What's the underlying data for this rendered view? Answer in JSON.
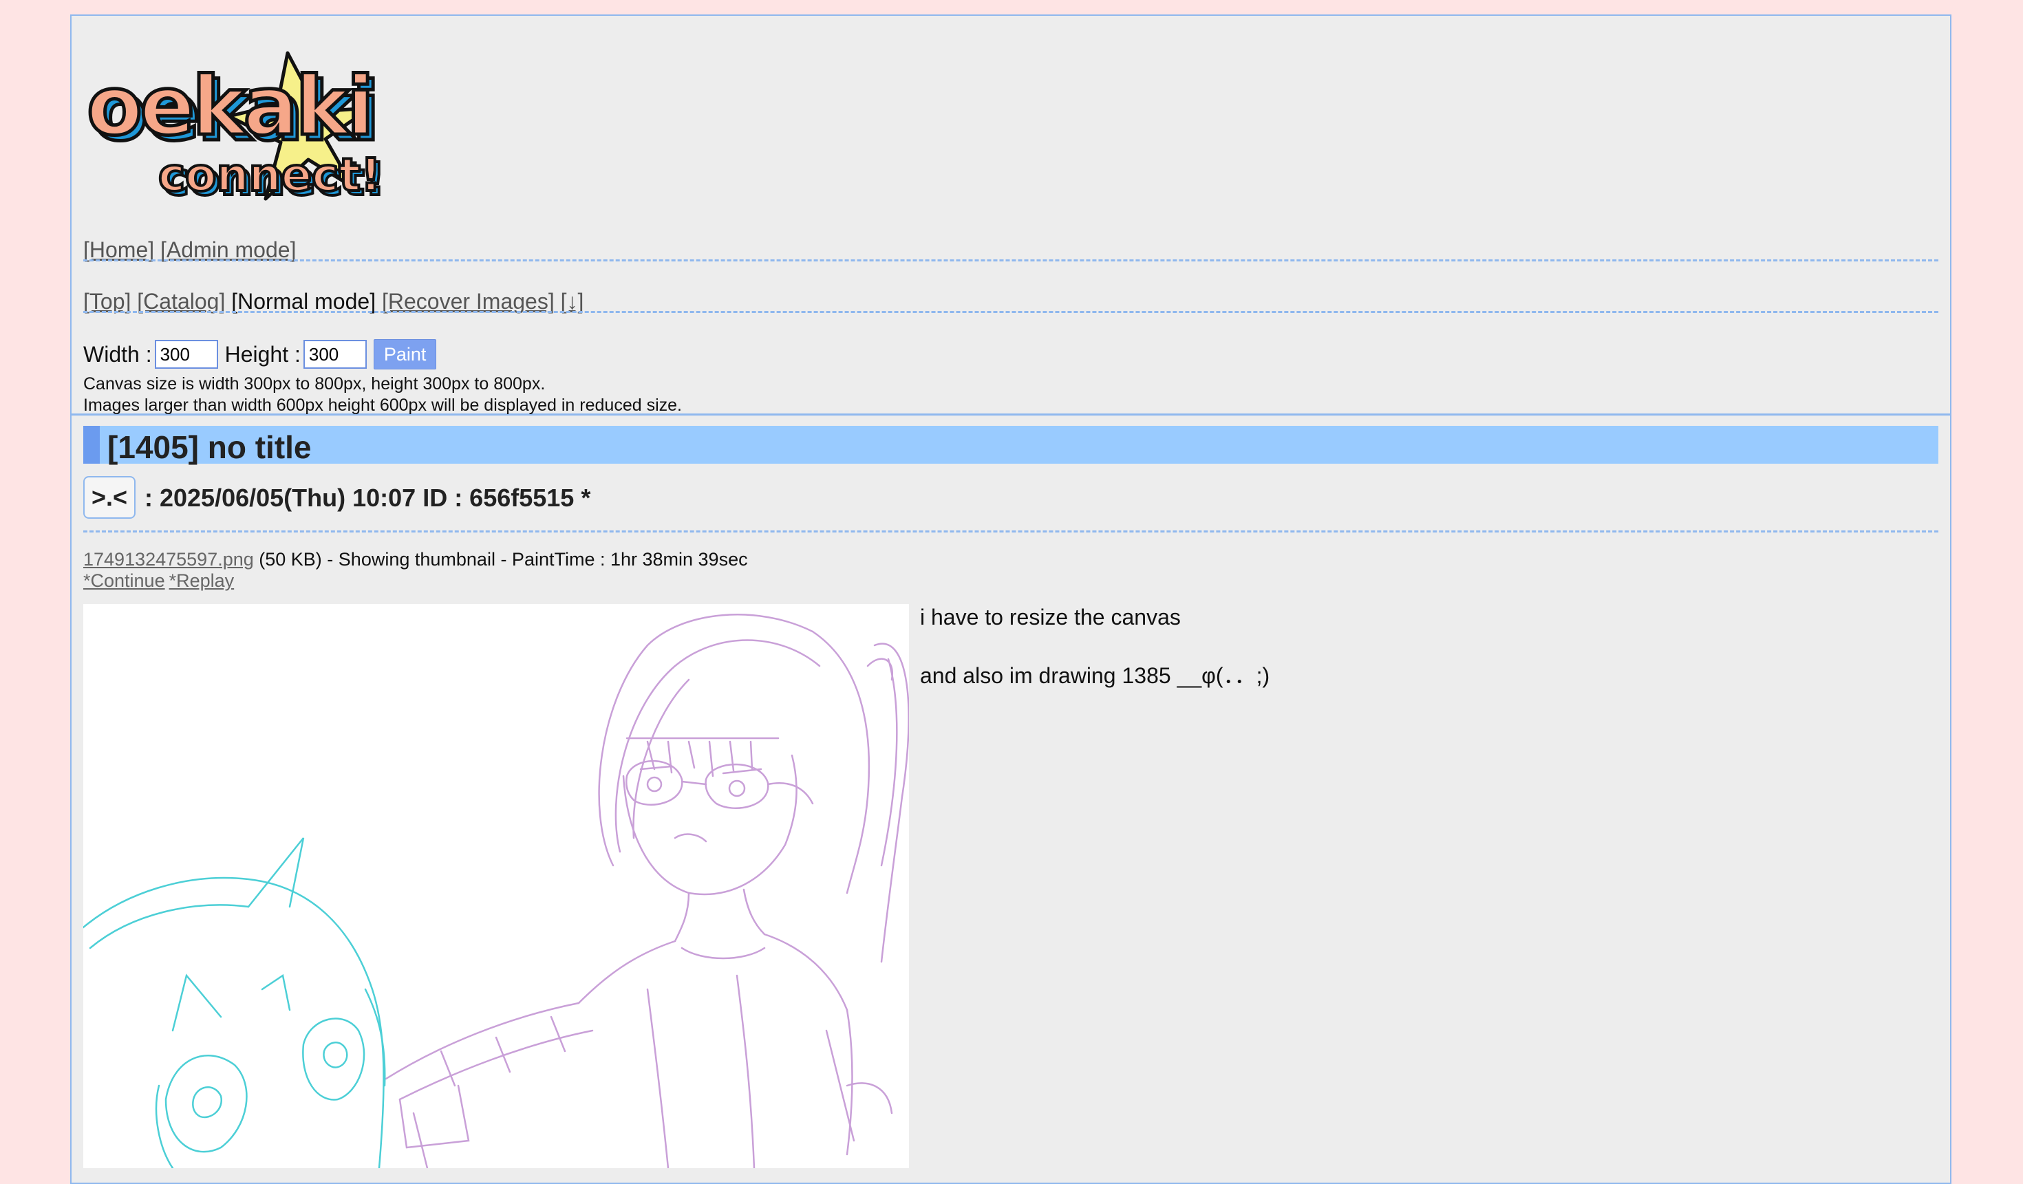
{
  "logo": {
    "line1": "oekaki",
    "line2": "connect!"
  },
  "top_nav": [
    {
      "label": "[Home]"
    },
    {
      "label": "[Admin mode]"
    }
  ],
  "board_nav": {
    "top": "[Top]",
    "catalog": "[Catalog]",
    "mode": "[Normal mode]",
    "recover": "[Recover Images]",
    "down": "[↓]"
  },
  "canvas_form": {
    "width_label": "Width :",
    "width_value": "300",
    "height_label": "Height :",
    "height_value": "300",
    "paint_button": "Paint",
    "note_size": "Canvas size is width 300px to 800px, height 300px to 800px.",
    "note_reduce": "Images larger than width 600px height 600px will be displayed in reduced size."
  },
  "post": {
    "title": "[1405] no title",
    "reply_button": ">.<",
    "meta": ": 2025/06/05(Thu) 10:07 ID : 656f5515 *",
    "file_name": "1749132475597.png",
    "file_details": " (50 KB) - Showing thumbnail - PaintTime : 1hr 38min 39sec",
    "continue_link": "*Continue",
    "replay_link": "*Replay",
    "comment_lines": [
      "i have to resize the canvas",
      "and also im drawing 1385 __φ(．．;)"
    ]
  },
  "colors": {
    "background": "#fee4e4",
    "panel": "#ededed",
    "accent_border": "#8fb8ee",
    "title_bar": "#99cbff",
    "button": "#7da1f0",
    "sketch_purple": "#c9a0d8",
    "sketch_cyan": "#4ccfd6"
  }
}
